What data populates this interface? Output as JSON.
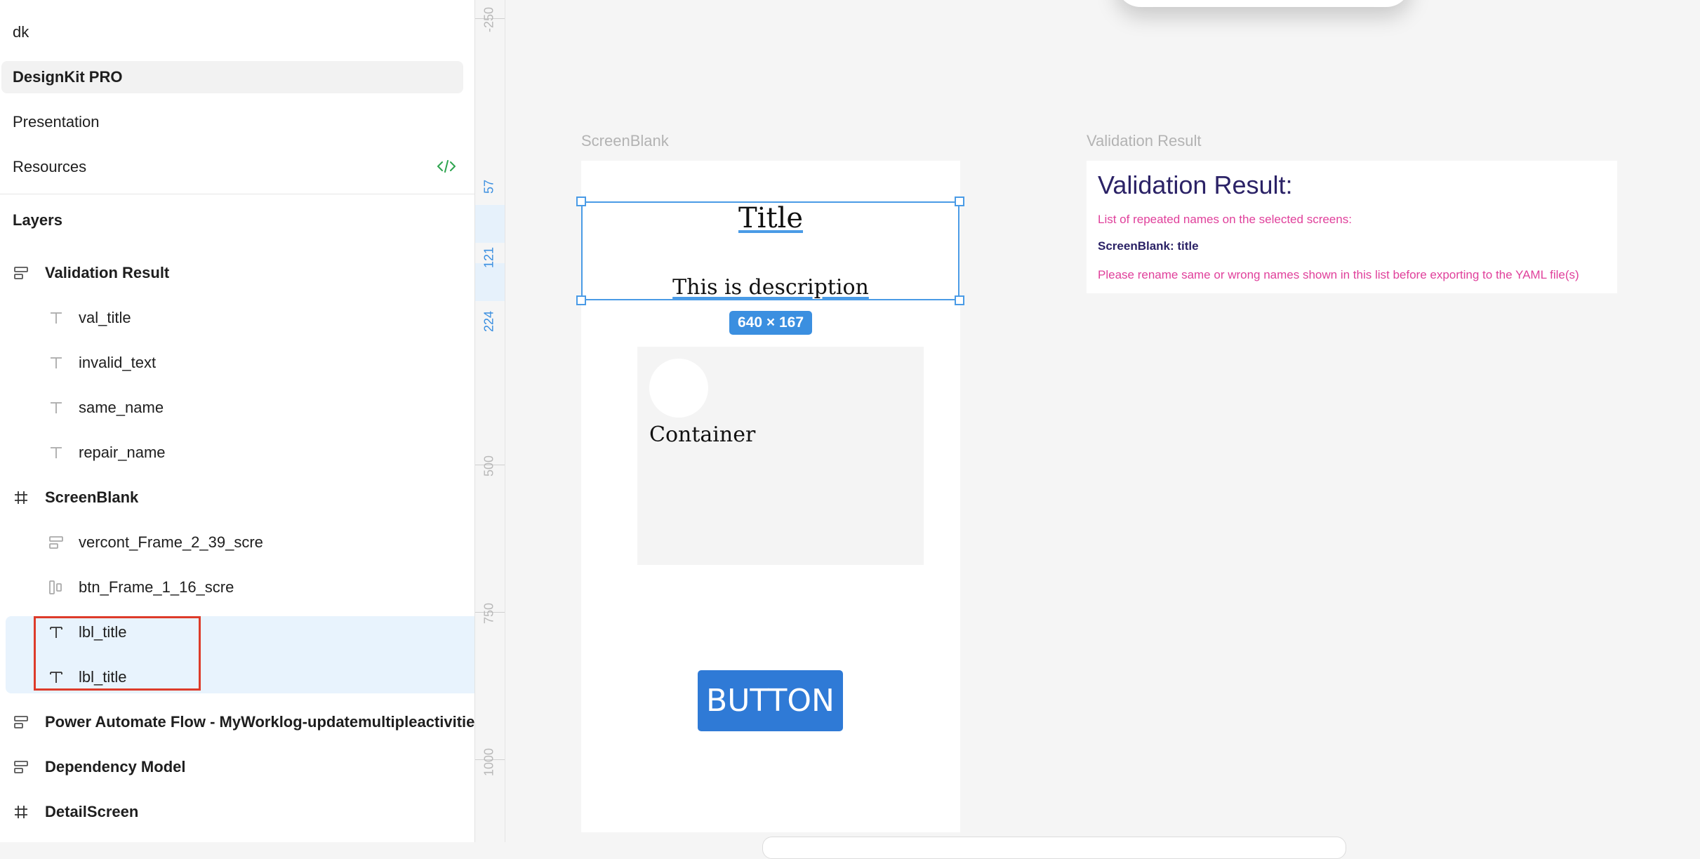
{
  "sidebar": {
    "pages": [
      {
        "label": "dk"
      },
      {
        "label": "DesignKit PRO"
      },
      {
        "label": "Presentation"
      },
      {
        "label": "Resources"
      }
    ],
    "layers_title": "Layers",
    "layers": [
      {
        "label": "Validation Result",
        "icon": "vertical-stack-icon"
      },
      {
        "label": "val_title",
        "icon": "text-icon"
      },
      {
        "label": "invalid_text",
        "icon": "text-icon"
      },
      {
        "label": "same_name",
        "icon": "text-icon"
      },
      {
        "label": "repair_name",
        "icon": "text-icon"
      },
      {
        "label": "ScreenBlank",
        "icon": "frame-icon"
      },
      {
        "label": "vercont_Frame_2_39_scre",
        "icon": "vertical-stack-icon"
      },
      {
        "label": "btn_Frame_1_16_scre",
        "icon": "horizontal-stack-icon"
      },
      {
        "label": "lbl_title",
        "icon": "text-icon"
      },
      {
        "label": "lbl_title",
        "icon": "text-icon"
      },
      {
        "label": "Power Automate Flow - MyWorklog-updatemultipleactivities",
        "icon": "vertical-stack-icon"
      },
      {
        "label": "Dependency Model",
        "icon": "vertical-stack-icon"
      },
      {
        "label": "DetailScreen",
        "icon": "frame-icon"
      }
    ]
  },
  "ruler": {
    "labels": [
      "-250",
      "57",
      "121",
      "224",
      "500",
      "750",
      "1000"
    ]
  },
  "canvas": {
    "screen_frame_label": "ScreenBlank",
    "validation_frame_label": "Validation Result",
    "screen": {
      "title": "Title",
      "description": "This is description",
      "selection_size": "640 × 167",
      "container_label": "Container",
      "button_label": "BUTTON"
    },
    "validation": {
      "heading": "Validation Result:",
      "line1": "List of repeated names on the selected screens:",
      "line2": "ScreenBlank: title",
      "line3": "Please rename same or wrong names shown in this list before exporting to the YAML file(s)"
    }
  },
  "colors": {
    "selection_blue": "#4a9be6",
    "button_blue": "#2f7ad6",
    "highlight_red": "#dd3b2a",
    "validation_heading": "#2b2266",
    "validation_pink": "#e0409b"
  }
}
